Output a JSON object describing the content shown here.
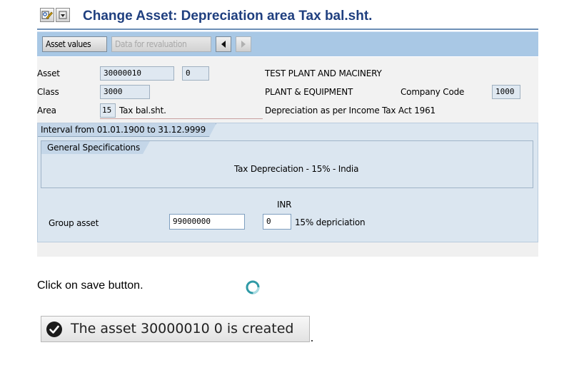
{
  "title": "Change Asset: Depreciation area Tax bal.sht.",
  "title_icons": [
    "display-change-icon",
    "menu-icon"
  ],
  "toolbar": {
    "asset_values_label": "Asset values",
    "revaluation_label": "Data for revaluation",
    "prev_icon": "triangle-left-icon",
    "next_icon": "triangle-right-icon"
  },
  "header": {
    "asset_label": "Asset",
    "asset_number": "30000010",
    "asset_subnumber": "0",
    "asset_description": "TEST PLANT AND MACINERY",
    "class_label": "Class",
    "class_value": "3000",
    "class_description": "PLANT & EQUIPMENT",
    "company_code_label": "Company Code",
    "company_code_value": "1000",
    "area_label": "Area",
    "area_value": "15",
    "area_name": "Tax bal.sht.",
    "area_description": "Depreciation as per Income Tax  Act 1961"
  },
  "interval": {
    "tab_label": "Interval from 01.01.1900 to 31.12.9999",
    "general_spec_label": "General Specifications",
    "general_spec_text": "Tax Depreciation - 15% - India",
    "currency": "INR",
    "group_asset_label": "Group asset",
    "group_asset_value": "99000000",
    "group_asset_subnumber": "0",
    "group_asset_description": "15% depriciation"
  },
  "instruction": "Click on save button.",
  "status": {
    "icon": "checkmark-circle-icon",
    "message": "The asset 30000010 0 is created"
  }
}
